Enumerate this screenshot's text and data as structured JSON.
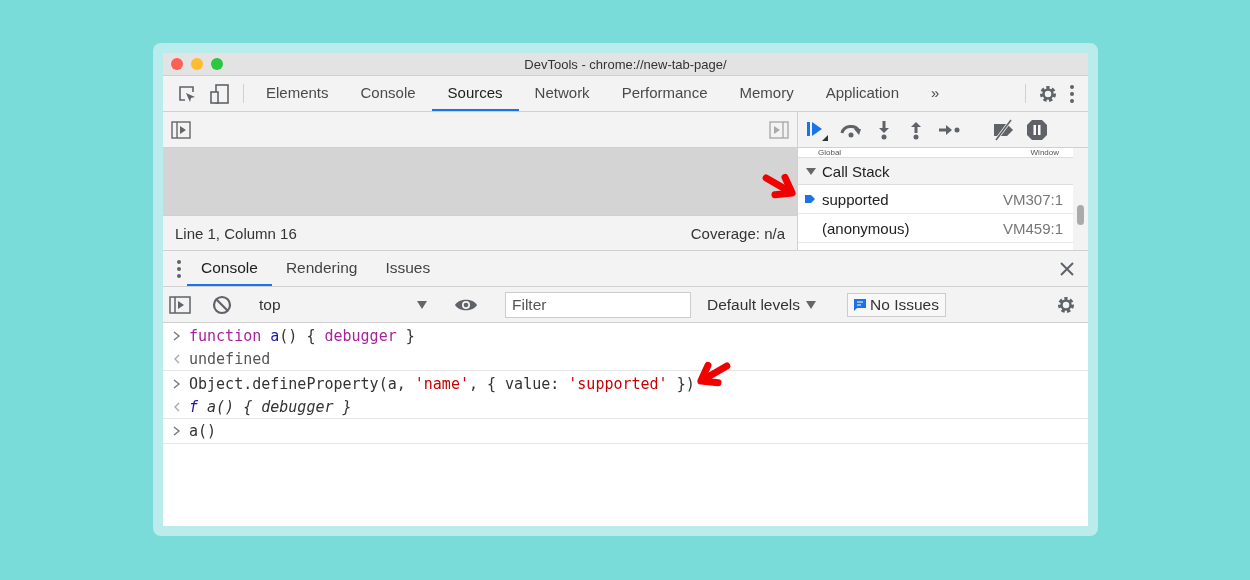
{
  "window": {
    "title": "DevTools - chrome://new-tab-page/"
  },
  "tabs": [
    {
      "label": "Elements",
      "selected": false
    },
    {
      "label": "Console",
      "selected": false
    },
    {
      "label": "Sources",
      "selected": true
    },
    {
      "label": "Network",
      "selected": false
    },
    {
      "label": "Performance",
      "selected": false
    },
    {
      "label": "Memory",
      "selected": false
    },
    {
      "label": "Application",
      "selected": false
    }
  ],
  "overflow": "»",
  "status_bar": {
    "position": "Line 1, Column 16",
    "coverage": "Coverage: n/a"
  },
  "scope": {
    "name": "Global",
    "value": "Window"
  },
  "call_stack": {
    "title": "Call Stack",
    "expanded": true,
    "frames": [
      {
        "name": "supported",
        "location": "VM307:1",
        "selected": true
      },
      {
        "name": "(anonymous)",
        "location": "VM459:1",
        "selected": false
      }
    ]
  },
  "drawer": {
    "tabs": [
      {
        "label": "Console",
        "selected": true
      },
      {
        "label": "Rendering",
        "selected": false
      },
      {
        "label": "Issues",
        "selected": false
      }
    ]
  },
  "console_toolbar": {
    "context": "top",
    "filter": {
      "placeholder": "Filter"
    },
    "levels": "Default levels",
    "issues": "No Issues"
  },
  "console_lines": [
    {
      "kind": "input",
      "tokens": [
        {
          "text": "function ",
          "kind": "keyword"
        },
        {
          "text": "a",
          "kind": "name"
        },
        {
          "text": "() { ",
          "kind": "plain"
        },
        {
          "text": "debugger",
          "kind": "keyword"
        },
        {
          "text": " }",
          "kind": "plain"
        }
      ]
    },
    {
      "kind": "output",
      "tokens": [
        {
          "text": "undefined",
          "kind": "muted"
        }
      ]
    },
    {
      "kind": "input",
      "tokens": [
        {
          "text": "Object.defineProperty(a, ",
          "kind": "plain"
        },
        {
          "text": "'name'",
          "kind": "string"
        },
        {
          "text": ", { value: ",
          "kind": "plain"
        },
        {
          "text": "'supported'",
          "kind": "string"
        },
        {
          "text": " })",
          "kind": "plain"
        }
      ]
    },
    {
      "kind": "output",
      "tokens": [
        {
          "text": "f",
          "kind": "fn"
        },
        {
          "text": " a() { debugger }",
          "kind": "italic"
        }
      ]
    },
    {
      "kind": "input",
      "tokens": [
        {
          "text": "a()",
          "kind": "plain"
        }
      ]
    }
  ]
}
